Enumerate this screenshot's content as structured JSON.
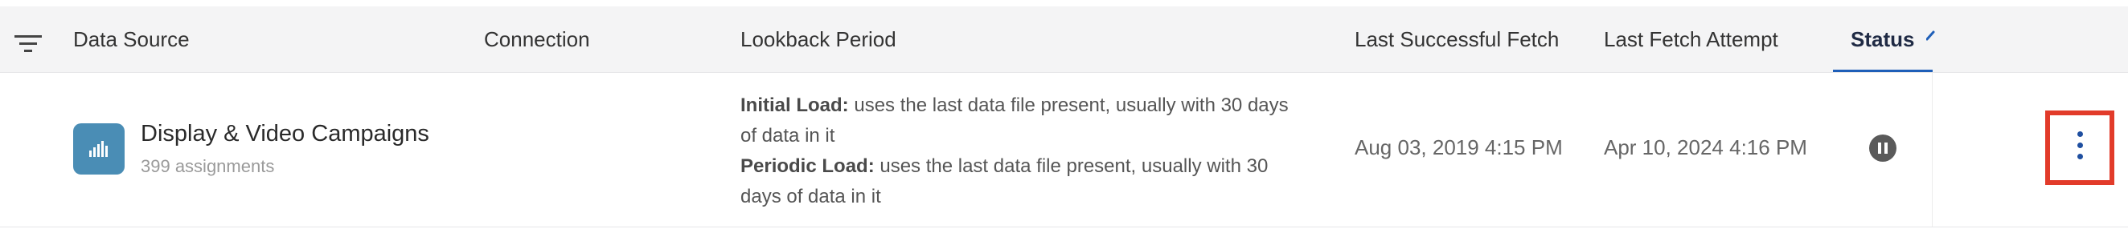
{
  "header": {
    "filter_icon": "filter-icon",
    "columns": {
      "data_source": "Data Source",
      "connection": "Connection",
      "lookback_period": "Lookback Period",
      "last_successful_fetch": "Last Successful Fetch",
      "last_fetch_attempt": "Last Fetch Attempt",
      "status": "Status"
    },
    "sort_icon": "sort-ascending-icon"
  },
  "row": {
    "source_icon": "bar-chart-icon",
    "icon_color": "#4a8db5",
    "name": "Display & Video Campaigns",
    "subtitle": "399 assignments",
    "connection": "",
    "lookback": {
      "initial_label": "Initial Load:",
      "initial_text": " uses the last data file present, usually with 30 days of data in it",
      "periodic_label": "Periodic Load:",
      "periodic_text": " uses the last data file present, usually with 30 days of data in it"
    },
    "last_successful_fetch": "Aug 03, 2019 4:15 PM",
    "last_fetch_attempt": "Apr 10, 2024 4:16 PM",
    "status_icon": "pause-icon",
    "actions_icon": "more-vertical-icon"
  },
  "colors": {
    "accent": "#1f5fb8",
    "highlight": "#e23b2a"
  }
}
